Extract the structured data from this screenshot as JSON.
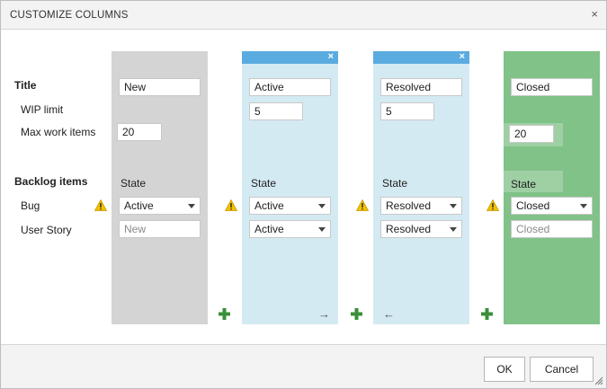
{
  "dialog": {
    "title": "CUSTOMIZE COLUMNS",
    "close_glyph": "×"
  },
  "labels": {
    "title": "Title",
    "wip_limit": "WIP limit",
    "max_work_items": "Max work items",
    "backlog_items": "Backlog items",
    "bug": "Bug",
    "user_story": "User Story"
  },
  "columns": [
    {
      "title": "New",
      "wip": "",
      "max_work_items": "20",
      "state_label": "State",
      "bug_state": "Active",
      "story_state": "New",
      "story_placeholder": true,
      "removable": false
    },
    {
      "title": "Active",
      "wip": "5",
      "state_label": "State",
      "bug_state": "Active",
      "story_state": "Active",
      "story_placeholder": false,
      "removable": true,
      "move_arrow": "→"
    },
    {
      "title": "Resolved",
      "wip": "5",
      "state_label": "State",
      "bug_state": "Resolved",
      "story_state": "Resolved",
      "story_placeholder": false,
      "removable": true,
      "move_arrow": "←"
    },
    {
      "title": "Closed",
      "wip": "",
      "max_work_items": "20",
      "state_label": "State",
      "bug_state": "Closed",
      "story_state": "Closed",
      "story_placeholder": true,
      "removable": false
    }
  ],
  "column_close_glyph": "×",
  "icons": {
    "warning": "warning-icon",
    "add_column": "plus-icon",
    "move_right": "arrow-right-icon",
    "move_left": "arrow-left-icon",
    "resize": "resize-grip-icon"
  },
  "colors": {
    "new_column": "#d4d4d4",
    "active_column": "#d4eaf2",
    "closed_column": "#80c288",
    "column_header": "#5aace0",
    "plus": "#3a8f3a",
    "warning": "#f2c200"
  },
  "footer": {
    "ok": "OK",
    "cancel": "Cancel"
  }
}
